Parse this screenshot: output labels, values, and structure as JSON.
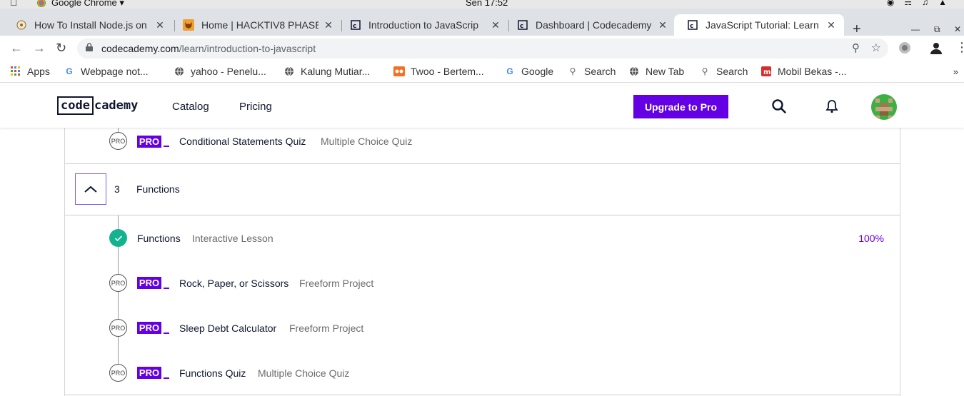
{
  "os": {
    "app_name": "Google Chrome",
    "clock": "Sen 17:52"
  },
  "browser": {
    "tabs": [
      {
        "label": "How To Install Node.js on",
        "favicon": "globe-icon"
      },
      {
        "label": "Home | HACKTIV8 PHASE",
        "favicon": "fox-icon"
      },
      {
        "label": "Introduction to JavaScrip",
        "favicon": "codecademy-icon"
      },
      {
        "label": "Dashboard | Codecademy",
        "favicon": "codecademy-icon"
      },
      {
        "label": "JavaScript Tutorial: Learn",
        "favicon": "codecademy-icon"
      }
    ],
    "active_tab": 4,
    "url_host": "codecademy.com",
    "url_path": "/learn/introduction-to-javascript",
    "bookmarks": [
      {
        "label": "Apps",
        "icon": "apps-grid-icon"
      },
      {
        "label": "Webpage not...",
        "icon": "google-icon"
      },
      {
        "label": "yahoo - Penelu...",
        "icon": "globe-icon"
      },
      {
        "label": "Kalung Mutiar...",
        "icon": "globe-icon"
      },
      {
        "label": "Twoo - Bertem...",
        "icon": "twoo-icon"
      },
      {
        "label": "Google",
        "icon": "google-icon"
      },
      {
        "label": "Search",
        "icon": "search-icon"
      },
      {
        "label": "New Tab",
        "icon": "globe-icon"
      },
      {
        "label": "Search",
        "icon": "search-icon"
      },
      {
        "label": "Mobil Bekas -...",
        "icon": "car-icon"
      }
    ],
    "more": "»"
  },
  "header": {
    "logo_code": "code",
    "logo_rest": "cademy",
    "nav": [
      "Catalog",
      "Pricing"
    ],
    "upgrade_label": "Upgrade to Pro"
  },
  "syllabus": {
    "top_item": {
      "badge": "PRO",
      "circle": "PRO",
      "title": "Conditional Statements Quiz",
      "type": "Multiple Choice Quiz"
    },
    "module": {
      "number": "3",
      "title": "Functions"
    },
    "items": [
      {
        "completed": true,
        "title": "Functions",
        "type": "Interactive Lesson",
        "progress": "100%"
      },
      {
        "completed": false,
        "badge": "PRO",
        "circle": "PRO",
        "title": "Rock, Paper, or Scissors",
        "type": "Freeform Project"
      },
      {
        "completed": false,
        "badge": "PRO",
        "circle": "PRO",
        "title": "Sleep Debt Calculator",
        "type": "Freeform Project"
      },
      {
        "completed": false,
        "badge": "PRO",
        "circle": "PRO",
        "title": "Functions Quiz",
        "type": "Multiple Choice Quiz"
      }
    ]
  },
  "colors": {
    "brand_purple": "#6400e4",
    "success_green": "#13b38f",
    "ink": "#10162f"
  }
}
